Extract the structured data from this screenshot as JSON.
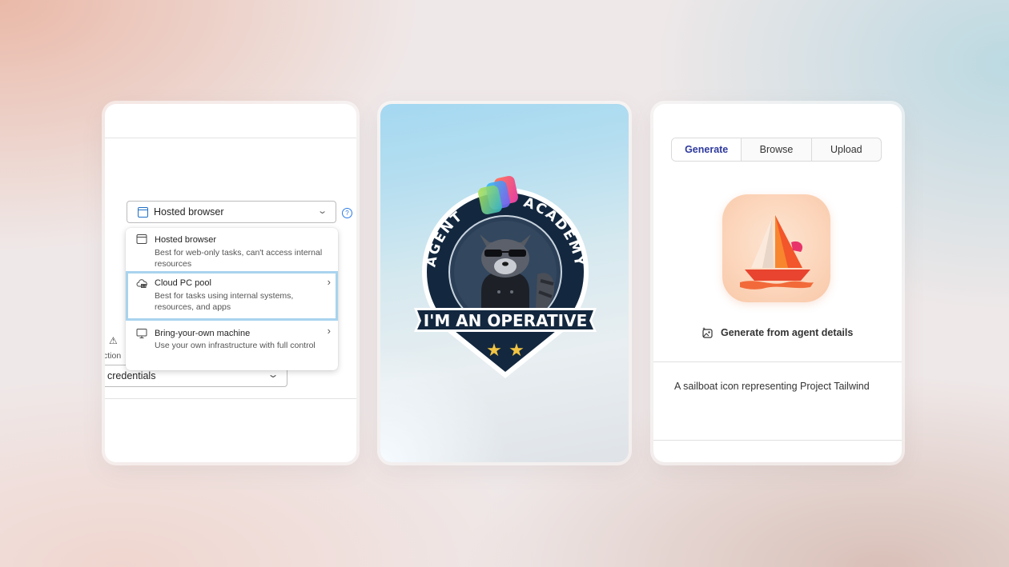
{
  "left_panel": {
    "select": {
      "value": "Hosted browser",
      "icon": "browser-window-icon"
    },
    "options": [
      {
        "title": "Hosted browser",
        "description": "Best for web-only tasks, can't access internal resources",
        "icon": "browser-window-icon",
        "selected": false
      },
      {
        "title": "Cloud PC pool",
        "description": "Best for tasks using internal systems, resources, and apps",
        "icon": "cloud-pc-icon",
        "selected": true
      },
      {
        "title": "Bring-your-own machine",
        "description": "Use your own infrastructure with full control",
        "icon": "monitor-icon",
        "selected": false
      }
    ],
    "background": {
      "partial_label": "ction",
      "credential_value": "credentials"
    }
  },
  "middle_panel": {
    "badge": {
      "top_text_left": "AGENT",
      "top_text_right": "ACADEMY",
      "banner_text": "I'M AN OPERATIVE",
      "stars": 2
    }
  },
  "right_panel": {
    "tabs": [
      {
        "label": "Generate",
        "active": true
      },
      {
        "label": "Browse",
        "active": false
      },
      {
        "label": "Upload",
        "active": false
      }
    ],
    "generate_label": "Generate from agent details",
    "prompt_text": "A sailboat icon representing Project Tailwind"
  },
  "colors": {
    "accent_blue": "#2e3a9e",
    "selection_highlight": "#a9d3ee",
    "badge_navy": "#13283f",
    "star_gold": "#f4c542"
  }
}
